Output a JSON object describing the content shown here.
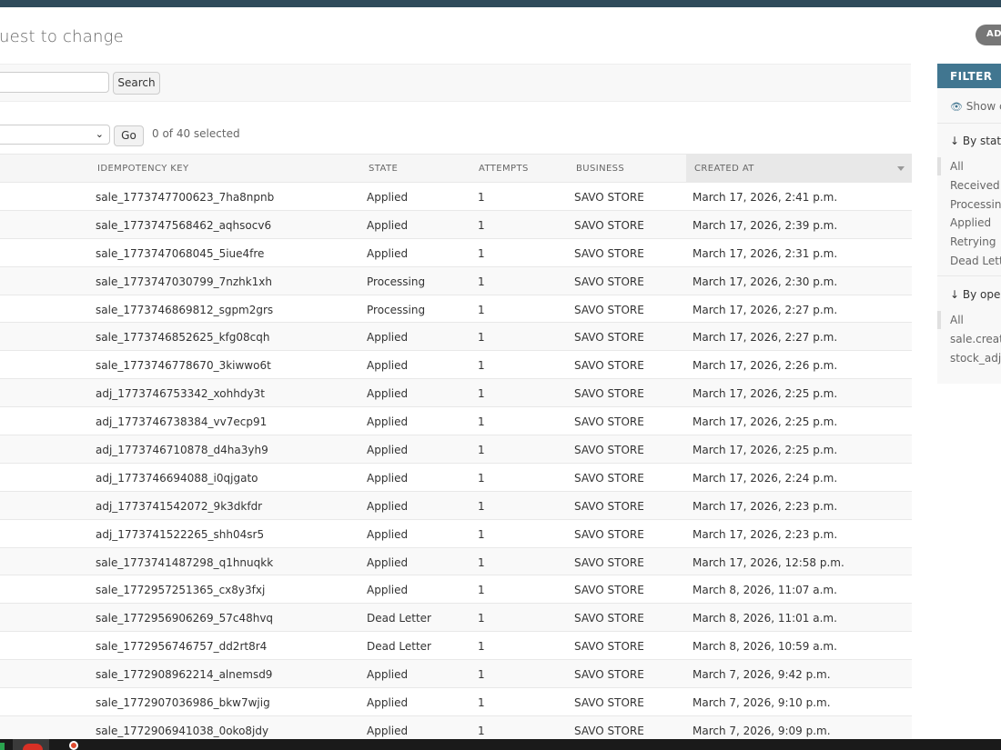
{
  "header": {
    "title": "uest to change",
    "add_label": "ADD"
  },
  "search": {
    "value": "",
    "button_label": "Search"
  },
  "actions": {
    "selected_value": "",
    "go_label": "Go",
    "selected_text": "0 of 40 selected"
  },
  "table": {
    "columns": {
      "key": "IDEMPOTENCY KEY",
      "state": "STATE",
      "attempts": "ATTEMPTS",
      "business": "BUSINESS",
      "created": "CREATED AT"
    },
    "rows": [
      {
        "key": "sale_1773747700623_7ha8npnb",
        "state": "Applied",
        "attempts": "1",
        "business": "SAVO STORE",
        "created": "March 17, 2026, 2:41 p.m."
      },
      {
        "key": "sale_1773747568462_aqhsocv6",
        "state": "Applied",
        "attempts": "1",
        "business": "SAVO STORE",
        "created": "March 17, 2026, 2:39 p.m."
      },
      {
        "key": "sale_1773747068045_5iue4fre",
        "state": "Applied",
        "attempts": "1",
        "business": "SAVO STORE",
        "created": "March 17, 2026, 2:31 p.m."
      },
      {
        "key": "sale_1773747030799_7nzhk1xh",
        "state": "Processing",
        "attempts": "1",
        "business": "SAVO STORE",
        "created": "March 17, 2026, 2:30 p.m."
      },
      {
        "key": "sale_1773746869812_sgpm2grs",
        "state": "Processing",
        "attempts": "1",
        "business": "SAVO STORE",
        "created": "March 17, 2026, 2:27 p.m."
      },
      {
        "key": "sale_1773746852625_kfg08cqh",
        "state": "Applied",
        "attempts": "1",
        "business": "SAVO STORE",
        "created": "March 17, 2026, 2:27 p.m."
      },
      {
        "key": "sale_1773746778670_3kiwwo6t",
        "state": "Applied",
        "attempts": "1",
        "business": "SAVO STORE",
        "created": "March 17, 2026, 2:26 p.m."
      },
      {
        "key": "adj_1773746753342_xohhdy3t",
        "state": "Applied",
        "attempts": "1",
        "business": "SAVO STORE",
        "created": "March 17, 2026, 2:25 p.m."
      },
      {
        "key": "adj_1773746738384_vv7ecp91",
        "state": "Applied",
        "attempts": "1",
        "business": "SAVO STORE",
        "created": "March 17, 2026, 2:25 p.m."
      },
      {
        "key": "adj_1773746710878_d4ha3yh9",
        "state": "Applied",
        "attempts": "1",
        "business": "SAVO STORE",
        "created": "March 17, 2026, 2:25 p.m."
      },
      {
        "key": "adj_1773746694088_i0qjgato",
        "state": "Applied",
        "attempts": "1",
        "business": "SAVO STORE",
        "created": "March 17, 2026, 2:24 p.m."
      },
      {
        "key": "adj_1773741542072_9k3dkfdr",
        "state": "Applied",
        "attempts": "1",
        "business": "SAVO STORE",
        "created": "March 17, 2026, 2:23 p.m."
      },
      {
        "key": "adj_1773741522265_shh04sr5",
        "state": "Applied",
        "attempts": "1",
        "business": "SAVO STORE",
        "created": "March 17, 2026, 2:23 p.m."
      },
      {
        "key": "sale_1773741487298_q1hnuqkk",
        "state": "Applied",
        "attempts": "1",
        "business": "SAVO STORE",
        "created": "March 17, 2026, 12:58 p.m."
      },
      {
        "key": "sale_1772957251365_cx8y3fxj",
        "state": "Applied",
        "attempts": "1",
        "business": "SAVO STORE",
        "created": "March 8, 2026, 11:07 a.m."
      },
      {
        "key": "sale_1772956906269_57c48hvq",
        "state": "Dead Letter",
        "attempts": "1",
        "business": "SAVO STORE",
        "created": "March 8, 2026, 11:01 a.m."
      },
      {
        "key": "sale_1772956746757_dd2rt8r4",
        "state": "Dead Letter",
        "attempts": "1",
        "business": "SAVO STORE",
        "created": "March 8, 2026, 10:59 a.m."
      },
      {
        "key": "sale_1772908962214_alnemsd9",
        "state": "Applied",
        "attempts": "1",
        "business": "SAVO STORE",
        "created": "March 7, 2026, 9:42 p.m."
      },
      {
        "key": "sale_1772907036986_bkw7wjig",
        "state": "Applied",
        "attempts": "1",
        "business": "SAVO STORE",
        "created": "March 7, 2026, 9:10 p.m."
      },
      {
        "key": "sale_1772906941038_0oko8jdy",
        "state": "Applied",
        "attempts": "1",
        "business": "SAVO STORE",
        "created": "March 7, 2026, 9:09 p.m."
      }
    ]
  },
  "filter": {
    "title": "FILTER",
    "show_counts": "Show c",
    "by_state": {
      "title": "↓ By state",
      "items": [
        "All",
        "Received",
        "Processing",
        "Applied",
        "Retrying",
        "Dead Lette"
      ]
    },
    "by_operation": {
      "title": "↓ By opera",
      "items": [
        "All",
        "sale.create",
        "stock_adju"
      ]
    }
  },
  "colors": {
    "topbar": "#2f4b5b",
    "filter_header": "#417690",
    "add_button": "#777777"
  }
}
